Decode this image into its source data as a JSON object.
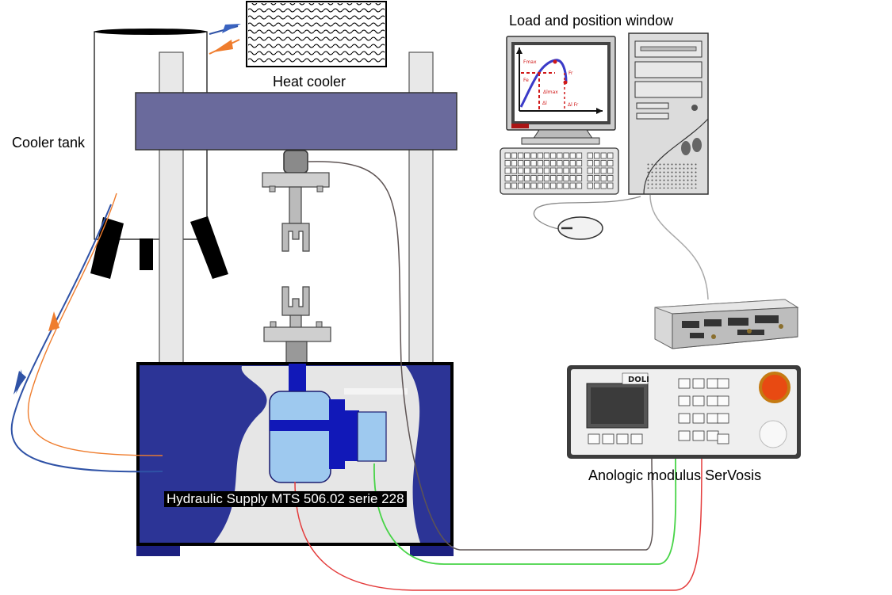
{
  "labels": {
    "heat_cooler": "Heat cooler",
    "cooler_tank": "Cooler tank",
    "load_position_window": "Load and position window",
    "analog_module": "Anologic modulus SerVosis",
    "hydraulic_supply": "Hydraulic Supply MTS 506.02 serie 228"
  },
  "screen_plot": {
    "axis_labels": [
      "Fmax",
      "Fe",
      "Fr",
      "Δlmax",
      "Δl",
      "Δl Fr"
    ]
  },
  "panel_brand": "DOLI",
  "colors": {
    "crosshead": "#6a6a9c",
    "base_frame": "#2c3496",
    "base_inner": "#e6e6e6",
    "pump": "#9ec9ef",
    "motor": "#1118b8",
    "coolant_in": "#2f52a6",
    "coolant_out": "#ef7d2e",
    "wire_grey": "#5e5454",
    "wire_green": "#47d447",
    "wire_red": "#e43c3c",
    "estop": "#e84a12"
  },
  "icons": [
    "heat-cooler-icon",
    "monitor-icon",
    "pc-tower-icon",
    "keyboard-icon",
    "mouse-icon",
    "controller-box-icon",
    "control-panel-icon",
    "emergency-stop-icon"
  ]
}
